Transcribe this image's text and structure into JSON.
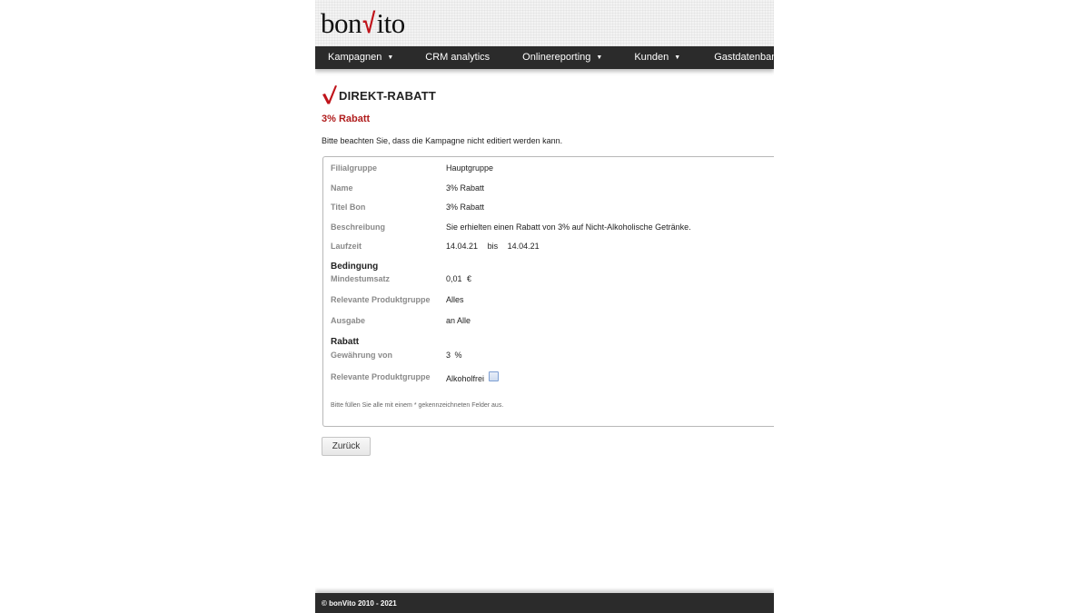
{
  "brand": {
    "logo_prefix": "bon",
    "logo_check": "√",
    "logo_suffix": "ito",
    "accent_color": "#c0141b"
  },
  "nav": {
    "items": [
      {
        "label": "Kampagnen",
        "dropdown": true,
        "caret": "▼"
      },
      {
        "label": "CRM analytics",
        "dropdown": false
      },
      {
        "label": "Onlinereporting",
        "dropdown": true,
        "caret": "▼"
      },
      {
        "label": "Kunden",
        "dropdown": true,
        "caret": "▼"
      },
      {
        "label": "Gastdatenbank",
        "dropdown": false
      }
    ]
  },
  "page": {
    "title": "DIREKT-RABATT",
    "title_icon": "red-check-icon",
    "subtitle": "3% Rabatt",
    "notice": "Bitte beachten Sie, dass die Kampagne nicht editiert werden kann."
  },
  "details": {
    "filialgruppe": {
      "label": "Filialgruppe",
      "value": "Hauptgruppe"
    },
    "name": {
      "label": "Name",
      "value": "3% Rabatt"
    },
    "titel_bon": {
      "label": "Titel Bon",
      "value": "3% Rabatt"
    },
    "beschreibung": {
      "label": "Beschreibung",
      "value": "Sie erhielten einen Rabatt von 3% auf Nicht-Alkoholische Getränke."
    },
    "laufzeit": {
      "label": "Laufzeit",
      "from": "14.04.21",
      "separator": "bis",
      "to": "14.04.21"
    }
  },
  "bedingung": {
    "heading": "Bedingung",
    "mindestumsatz": {
      "label": "Mindestumsatz",
      "value": "0,01",
      "unit": "€"
    },
    "produktgruppe": {
      "label": "Relevante Produktgruppe",
      "value": "Alles"
    },
    "ausgabe": {
      "label": "Ausgabe",
      "value": "an Alle"
    }
  },
  "rabatt": {
    "heading": "Rabatt",
    "gewaehrung": {
      "label": "Gewährung von",
      "value": "3",
      "unit": "%"
    },
    "produktgruppe": {
      "label": "Relevante Produktgruppe",
      "value": "Alkoholfrei",
      "checked": false
    }
  },
  "form": {
    "hint": "Bitte füllen Sie alle mit einem * gekennzeichneten Felder aus.",
    "back_label": "Zurück"
  },
  "footer": {
    "copyright": "© bonVito 2010 - 2021"
  }
}
